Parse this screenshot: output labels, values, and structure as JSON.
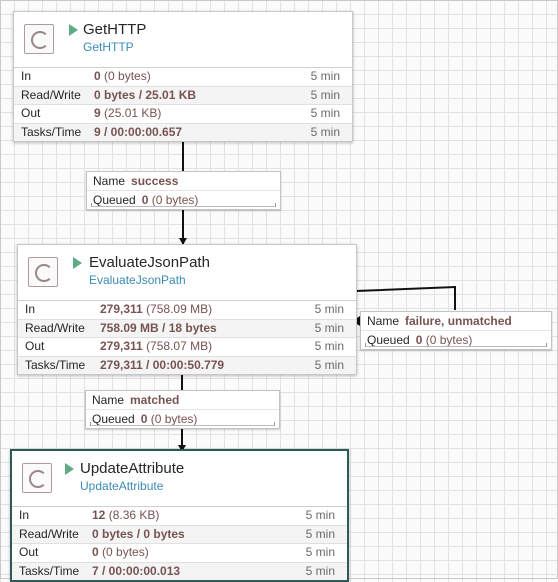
{
  "processors": [
    {
      "name": "GetHTTP",
      "type": "GetHTTP",
      "stats": [
        {
          "label": "In",
          "value": "0",
          "paren": "(0 bytes)",
          "time": "5 min"
        },
        {
          "label": "Read/Write",
          "value": "0 bytes / 25.01 KB",
          "paren": "",
          "time": "5 min"
        },
        {
          "label": "Out",
          "value": "9",
          "paren": "(25.01 KB)",
          "time": "5 min"
        },
        {
          "label": "Tasks/Time",
          "value": "9 / 00:00:00.657",
          "paren": "",
          "time": "5 min"
        }
      ]
    },
    {
      "name": "EvaluateJsonPath",
      "type": "EvaluateJsonPath",
      "stats": [
        {
          "label": "In",
          "value": "279,311",
          "paren": "(758.09 MB)",
          "time": "5 min"
        },
        {
          "label": "Read/Write",
          "value": "758.09 MB / 18 bytes",
          "paren": "",
          "time": "5 min"
        },
        {
          "label": "Out",
          "value": "279,311",
          "paren": "(758.07 MB)",
          "time": "5 min"
        },
        {
          "label": "Tasks/Time",
          "value": "279,311 / 00:00:50.779",
          "paren": "",
          "time": "5 min"
        }
      ]
    },
    {
      "name": "UpdateAttribute",
      "type": "UpdateAttribute",
      "stats": [
        {
          "label": "In",
          "value": "12",
          "paren": "(8.36 KB)",
          "time": "5 min"
        },
        {
          "label": "Read/Write",
          "value": "0 bytes / 0 bytes",
          "paren": "",
          "time": "5 min"
        },
        {
          "label": "Out",
          "value": "0",
          "paren": "(0 bytes)",
          "time": "5 min"
        },
        {
          "label": "Tasks/Time",
          "value": "7 / 00:00:00.013",
          "paren": "",
          "time": "5 min"
        }
      ]
    }
  ],
  "connections": [
    {
      "name_label": "Name",
      "name": "success",
      "queued_label": "Queued",
      "queued_count": "0",
      "queued_size": "(0 bytes)"
    },
    {
      "name_label": "Name",
      "name": "failure, unmatched",
      "queued_label": "Queued",
      "queued_count": "0",
      "queued_size": "(0 bytes)"
    },
    {
      "name_label": "Name",
      "name": "matched",
      "queued_label": "Queued",
      "queued_count": "0",
      "queued_size": "(0 bytes)"
    }
  ]
}
